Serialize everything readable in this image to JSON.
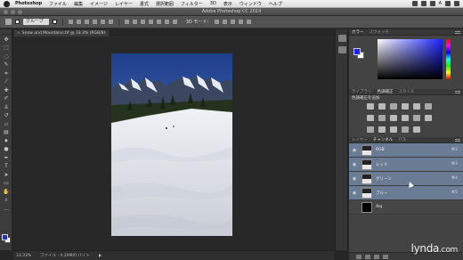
{
  "menubar": {
    "app_name": "Photoshop",
    "items": [
      "ファイル",
      "編集",
      "イメージ",
      "レイヤー",
      "書式",
      "選択範囲",
      "フィルター",
      "3D",
      "表示",
      "ウィンドウ",
      "ヘルプ"
    ],
    "right_text": "A"
  },
  "titlebar": {
    "title": "Adobe Photoshop CC 2014"
  },
  "options": {
    "auto_select_label": "グループ",
    "mode_3d": "3D モード："
  },
  "document": {
    "tab_title": "Snow and Mountains.tif @ 33.3% (RGB/8)"
  },
  "status": {
    "zoom": "33.33%",
    "file_info": "ファイル : 4.29M/0 バイト"
  },
  "tools": [
    {
      "name": "move-tool-icon",
      "glyph": "✥"
    },
    {
      "name": "marquee-tool-icon",
      "glyph": "⬚"
    },
    {
      "name": "lasso-tool-icon",
      "glyph": "◌"
    },
    {
      "name": "quick-select-tool-icon",
      "glyph": "✎"
    },
    {
      "name": "crop-tool-icon",
      "glyph": "⌗"
    },
    {
      "name": "eyedropper-tool-icon",
      "glyph": "⁄"
    },
    {
      "name": "healing-brush-tool-icon",
      "glyph": "✚"
    },
    {
      "name": "brush-tool-icon",
      "glyph": "✐"
    },
    {
      "name": "clone-stamp-tool-icon",
      "glyph": "♙"
    },
    {
      "name": "history-brush-tool-icon",
      "glyph": "↺"
    },
    {
      "name": "eraser-tool-icon",
      "glyph": "▱"
    },
    {
      "name": "gradient-tool-icon",
      "glyph": "▤"
    },
    {
      "name": "blur-tool-icon",
      "glyph": "♦"
    },
    {
      "name": "dodge-tool-icon",
      "glyph": "●"
    },
    {
      "name": "pen-tool-icon",
      "glyph": "✒"
    },
    {
      "name": "type-tool-icon",
      "glyph": "T"
    },
    {
      "name": "path-select-tool-icon",
      "glyph": "➤"
    },
    {
      "name": "shape-tool-icon",
      "glyph": "▭"
    },
    {
      "name": "hand-tool-icon",
      "glyph": "✋"
    },
    {
      "name": "zoom-tool-icon",
      "glyph": "⌕"
    },
    {
      "name": "more-tools-icon",
      "glyph": "…"
    }
  ],
  "color_panel": {
    "tabs": [
      "カラー",
      "スウォッチ"
    ],
    "foreground": "#1a22ff",
    "background": "#ffffff"
  },
  "adjust_panel": {
    "tabs": [
      "ライブラリ",
      "色調補正",
      "スタイル"
    ],
    "heading": "色調補正を追加"
  },
  "layers_panel": {
    "tabs": [
      "レイヤー",
      "チャンネル",
      "パス"
    ],
    "channels": [
      {
        "name": "RGB",
        "shortcut": "⌘2"
      },
      {
        "name": "レッド",
        "shortcut": "⌘3"
      },
      {
        "name": "グリーン",
        "shortcut": "⌘4"
      },
      {
        "name": "ブルー",
        "shortcut": "⌘5"
      },
      {
        "name": "Alq",
        "shortcut": ""
      }
    ]
  },
  "watermark": {
    "brand": "lynda",
    "domain": ".com"
  }
}
